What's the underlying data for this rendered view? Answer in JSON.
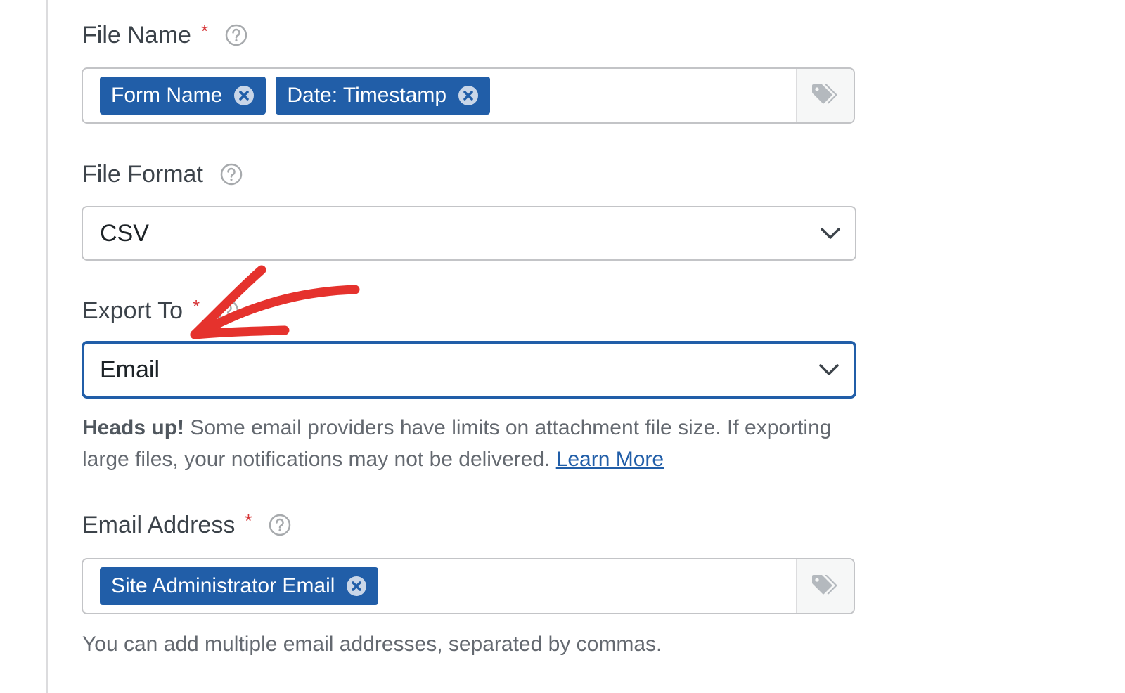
{
  "file_name": {
    "label": "File Name",
    "required_mark": "*",
    "help_icon": "question-circle-icon",
    "tags": [
      {
        "label": "Form Name",
        "remove_icon": "remove-circle-icon"
      },
      {
        "label": "Date: Timestamp",
        "remove_icon": "remove-circle-icon"
      }
    ],
    "tag_picker_icon": "tags-icon"
  },
  "file_format": {
    "label": "File Format",
    "help_icon": "question-circle-icon",
    "value": "CSV",
    "dropdown_icon": "chevron-down-icon"
  },
  "export_to": {
    "label": "Export To",
    "required_mark": "*",
    "help_icon": "question-circle-icon",
    "value": "Email",
    "dropdown_icon": "chevron-down-icon",
    "notice_strong": "Heads up!",
    "notice_text": " Some email providers have limits on attachment file size. If exporting large files, your notifications may not be delivered. ",
    "notice_link": "Learn More"
  },
  "email_address": {
    "label": "Email Address",
    "required_mark": "*",
    "help_icon": "question-circle-icon",
    "tags": [
      {
        "label": "Site Administrator Email",
        "remove_icon": "remove-circle-icon"
      }
    ],
    "tag_picker_icon": "tags-icon",
    "hint": "You can add multiple email addresses, separated by commas."
  },
  "annotation": {
    "icon": "red-arrow-annotation"
  },
  "colors": {
    "accent": "#215ea8",
    "required": "#d63638",
    "annotation": "#e5322d",
    "text": "#3c434a",
    "muted": "#646970",
    "border": "#c3c4c7"
  }
}
